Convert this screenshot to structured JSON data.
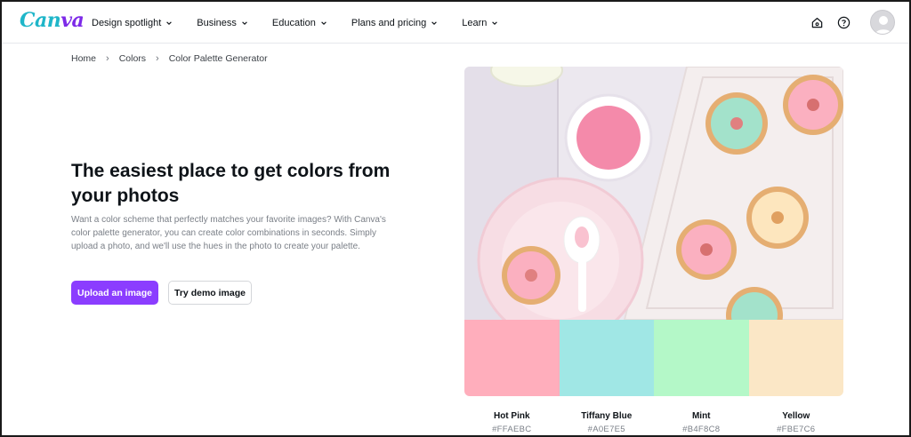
{
  "header": {
    "logo": "Canva",
    "nav": [
      {
        "label": "Design spotlight"
      },
      {
        "label": "Business"
      },
      {
        "label": "Education"
      },
      {
        "label": "Plans and pricing"
      },
      {
        "label": "Learn"
      }
    ],
    "icons": [
      "home-icon",
      "help-icon",
      "avatar"
    ]
  },
  "breadcrumb": [
    "Home",
    "Colors",
    "Color Palette Generator"
  ],
  "hero": {
    "title": "The easiest place to get colors from your photos",
    "description": "Want a color scheme that perfectly matches your favorite images? With Canva's color palette generator, you can create color combinations in seconds. Simply upload a photo, and we'll use the hues in the photo to create your palette.",
    "primary_button": "Upload an image",
    "secondary_button": "Try demo image"
  },
  "palette": [
    {
      "name": "Hot Pink",
      "hex": "#FFAEBC"
    },
    {
      "name": "Tiffany Blue",
      "hex": "#A0E7E5"
    },
    {
      "name": "Mint",
      "hex": "#B4F8C8"
    },
    {
      "name": "Yellow",
      "hex": "#FBE7C6"
    }
  ],
  "colors": {
    "brand_purple": "#8B3DFF",
    "logo_teal": "#1FB6C9"
  }
}
